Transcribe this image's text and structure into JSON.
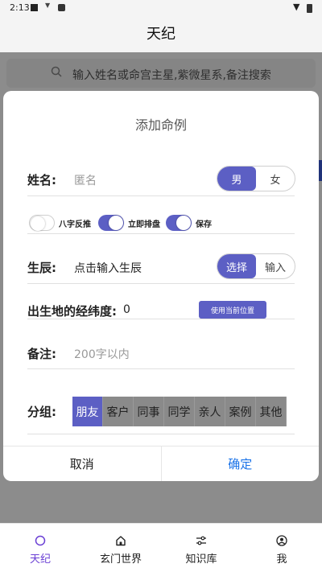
{
  "status_bar": {
    "time": "2:13"
  },
  "header": {
    "title": "天纪"
  },
  "background": {
    "search_placeholder": "输入姓名或命宫主星,紫微星系,备注搜索"
  },
  "dialog": {
    "title": "添加命例",
    "name": {
      "label": "姓名:",
      "placeholder": "匿名",
      "gender_options": [
        "男",
        "女"
      ],
      "selected_gender": "男"
    },
    "toggles": [
      {
        "label": "八字反推",
        "on": false
      },
      {
        "label": "立即排盘",
        "on": true
      },
      {
        "label": "保存",
        "on": true
      }
    ],
    "birth_time": {
      "label": "生辰:",
      "value": "点击输入生辰",
      "mode_options": [
        "选择",
        "输入"
      ],
      "selected_mode": "选择"
    },
    "location": {
      "label": "出生地的经纬度:",
      "value": "0",
      "button_label": "使用当前位置"
    },
    "note": {
      "label": "备注:",
      "placeholder": "200字以内"
    },
    "group": {
      "label": "分组:",
      "options": [
        "朋友",
        "客户",
        "同事",
        "同学",
        "亲人",
        "案例",
        "其他"
      ],
      "selected": "朋友"
    },
    "cancel_label": "取消",
    "confirm_label": "确定"
  },
  "bottom_nav": {
    "items": [
      {
        "label": "天纪",
        "icon": "circle-icon",
        "active": true
      },
      {
        "label": "玄门世界",
        "icon": "home-icon",
        "active": false
      },
      {
        "label": "知识库",
        "icon": "sliders-icon",
        "active": false
      },
      {
        "label": "我",
        "icon": "user-icon",
        "active": false
      }
    ]
  },
  "colors": {
    "accent": "#5c5fc4",
    "active_nav": "#6a3fd4",
    "confirm": "#1a73e8",
    "chip_inactive": "#8a8a8a"
  }
}
